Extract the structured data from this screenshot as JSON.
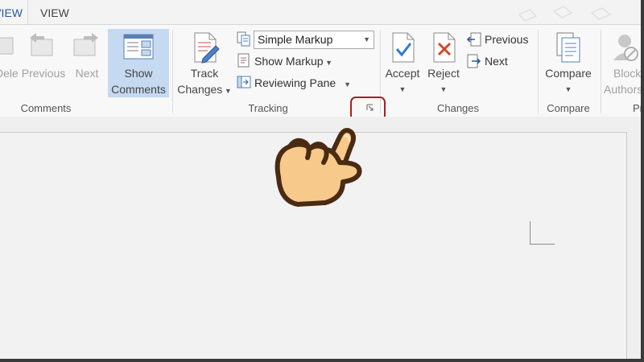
{
  "tabs": {
    "review": "REVIEW",
    "view": "VIEW"
  },
  "comments_group": {
    "delete_label": "Delete",
    "previous_label": "Previous",
    "next_label": "Next",
    "show_comments_line1": "Show",
    "show_comments_line2": "Comments",
    "group_label": "Comments"
  },
  "tracking_group": {
    "track_changes_line1": "Track",
    "track_changes_line2": "Changes",
    "markup_select_value": "Simple Markup",
    "show_markup_label": "Show Markup",
    "reviewing_pane_label": "Reviewing Pane",
    "group_label": "Tracking"
  },
  "changes_group": {
    "accept_label": "Accept",
    "reject_label": "Reject",
    "previous_label": "Previous",
    "next_label": "Next",
    "group_label": "Changes"
  },
  "compare_group": {
    "compare_label": "Compare",
    "group_label": "Compare"
  },
  "protect_group": {
    "block_line1": "Block",
    "block_line2": "Authors",
    "group_label": "Protect"
  },
  "colors": {
    "accent": "#2b579a",
    "highlight": "#c5d9f0",
    "callout": "#b11c1c",
    "hand_fill": "#f7c98b",
    "hand_outline": "#4a2a12"
  }
}
